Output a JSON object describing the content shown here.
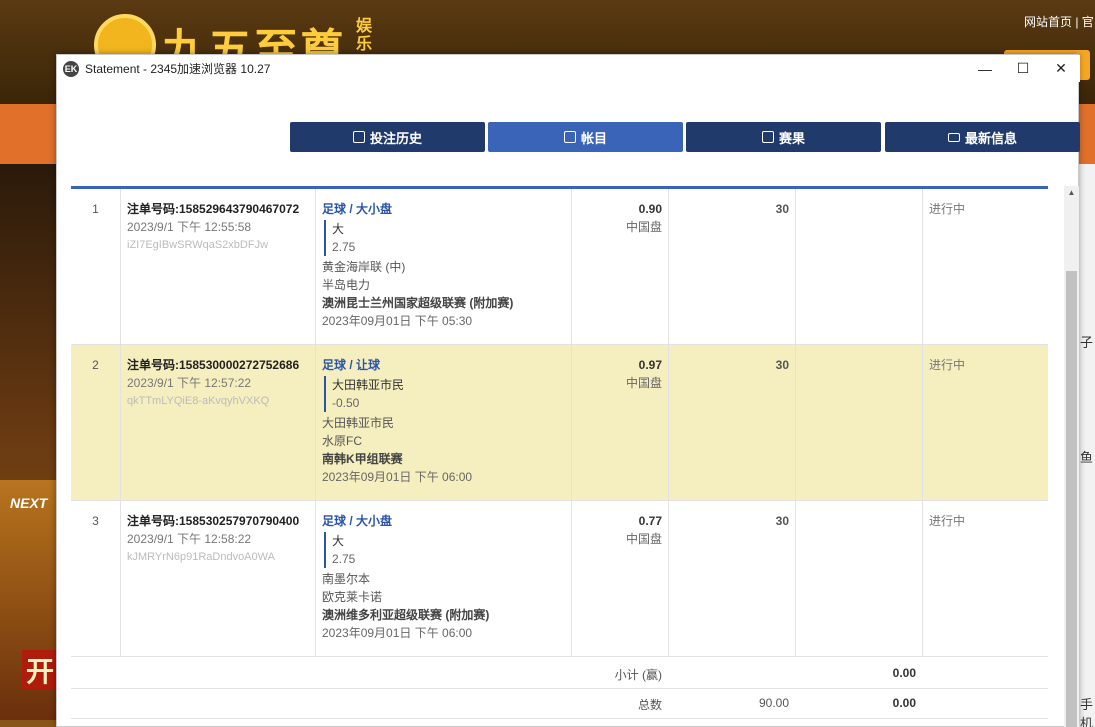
{
  "background": {
    "logo_text": "九五至尊",
    "logo_small": "娱乐",
    "top_links": "网站首页 | 官",
    "left_badge": "NEXT",
    "left_banner": "开",
    "right_texts": [
      "子",
      "鱼",
      "手机"
    ]
  },
  "window": {
    "icon": "EK",
    "title": "Statement - 2345加速浏览器 10.27"
  },
  "tabs": [
    {
      "label": "投注历史",
      "icon": "clipboard-icon",
      "active": false
    },
    {
      "label": "帐目",
      "icon": "receipt-icon",
      "active": true
    },
    {
      "label": "赛果",
      "icon": "results-icon",
      "active": false
    },
    {
      "label": "最新信息",
      "icon": "envelope-icon",
      "active": false
    }
  ],
  "rows": [
    {
      "num": "1",
      "order_no": "注单号码:158529643790467072",
      "date": "2023/9/1 下午 12:55:58",
      "id": "iZI7EgIBwSRWqaS2xbDFJw",
      "sport": "足球 / 大小盘",
      "pick": "大",
      "handicap": "2.75",
      "home": "黄金海岸联 (中)",
      "away": "半岛电力",
      "league": "澳洲昆士兰州国家超级联赛 (附加赛)",
      "kickoff": "2023年09月01日 下午 05:30",
      "odds": "0.90",
      "odds_type": "中国盘",
      "stake": "30",
      "status": "进行中",
      "highlight": false
    },
    {
      "num": "2",
      "order_no": "注单号码:158530000272752686",
      "date": "2023/9/1 下午 12:57:22",
      "id": "qkTTmLYQiE8-aKvqyhVXKQ",
      "sport": "足球 / 让球",
      "pick": "大田韩亚市民",
      "handicap": "-0.50",
      "home": "大田韩亚市民",
      "away": "水原FC",
      "league": "南韩K甲组联赛",
      "kickoff": "2023年09月01日 下午 06:00",
      "odds": "0.97",
      "odds_type": "中国盘",
      "stake": "30",
      "status": "进行中",
      "highlight": true
    },
    {
      "num": "3",
      "order_no": "注单号码:158530257970790400",
      "date": "2023/9/1 下午 12:58:22",
      "id": "kJMRYrN6p91RaDndvoA0WA",
      "sport": "足球 / 大小盘",
      "pick": "大",
      "handicap": "2.75",
      "home": "南墨尔本",
      "away": "欧克莱卡诺",
      "league": "澳洲维多利亚超级联赛 (附加赛)",
      "kickoff": "2023年09月01日 下午 06:00",
      "odds": "0.77",
      "odds_type": "中国盘",
      "stake": "30",
      "status": "进行中",
      "highlight": false
    }
  ],
  "summary": {
    "subtotal_label": "小计 (赢)",
    "subtotal_stake": "",
    "subtotal_win": "0.00",
    "total_label": "总数",
    "total_stake": "90.00",
    "total_win": "0.00"
  },
  "colors": {
    "tab_bg": "#1f3a6b",
    "tab_active": "#3a64b8",
    "highlight_row": "#f5efbf",
    "sport_text": "#2a55a8"
  }
}
